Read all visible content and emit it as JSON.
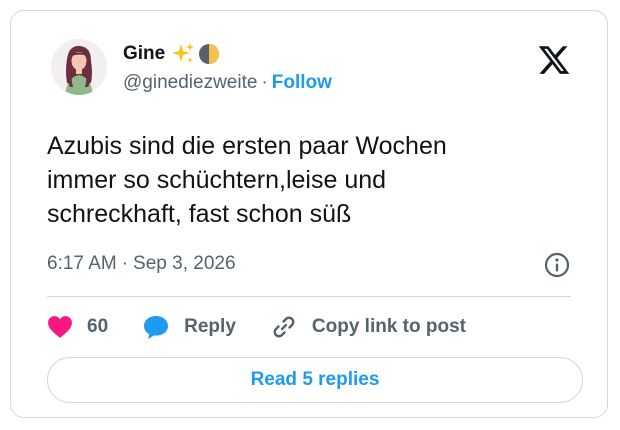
{
  "author": {
    "display_name": "Gine",
    "name_emojis": [
      "sparkles-icon",
      "half-moon-icon"
    ],
    "handle": "@ginediezweite",
    "separator": "·",
    "follow_label": "Follow"
  },
  "tweet": {
    "text": "Azubis sind die ersten paar Wochen\nimmer so schüchtern,leise und\nschreckhaft, fast schon süß",
    "time": "6:17 AM",
    "separator": "·",
    "date": "Sep 3, 2026"
  },
  "actions": {
    "like_count": "60",
    "reply_label": "Reply",
    "copy_link_label": "Copy link to post"
  },
  "read_replies_label": "Read 5 replies",
  "colors": {
    "like": "#f91880",
    "reply": "#1d9bf0",
    "link_blue": "#1d9bf0",
    "muted": "#536471",
    "text": "#0f1419",
    "border": "#cfd9de"
  }
}
